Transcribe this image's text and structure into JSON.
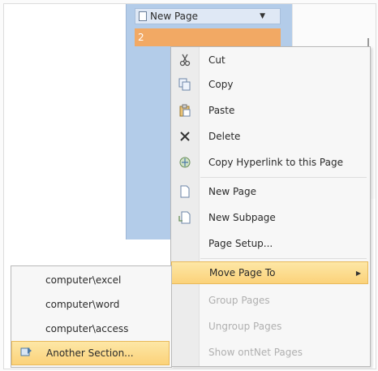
{
  "page_list": {
    "header_label": "New Page",
    "selected_label": "2"
  },
  "context_menu": {
    "items": [
      {
        "label": "Cut",
        "icon": "scissors-icon"
      },
      {
        "label": "Copy",
        "icon": "copy-icon"
      },
      {
        "label": "Paste",
        "icon": "paste-icon"
      },
      {
        "label": "Delete",
        "icon": "delete-icon"
      },
      {
        "label": "Copy Hyperlink to this Page",
        "icon": "hyperlink-icon"
      },
      {
        "label": "New Page",
        "icon": "new-page-icon"
      },
      {
        "label": "New Subpage",
        "icon": "new-subpage-icon"
      },
      {
        "label": "Page Setup...",
        "icon": ""
      },
      {
        "label": "Move Page To",
        "icon": ""
      },
      {
        "label": "Group Pages",
        "icon": ""
      },
      {
        "label": "Ungroup Pages",
        "icon": ""
      },
      {
        "label": "Show ontNet Pages",
        "icon": ""
      }
    ]
  },
  "submenu": {
    "items": [
      {
        "label": "computer\\excel"
      },
      {
        "label": "computer\\word"
      },
      {
        "label": "computer\\access"
      },
      {
        "label": "Another Section...",
        "icon": "section-icon"
      }
    ]
  },
  "colors": {
    "pane_blue": "#b3cce9",
    "selected_orange": "#f2a964",
    "highlight_gold": "#fbd27a"
  }
}
